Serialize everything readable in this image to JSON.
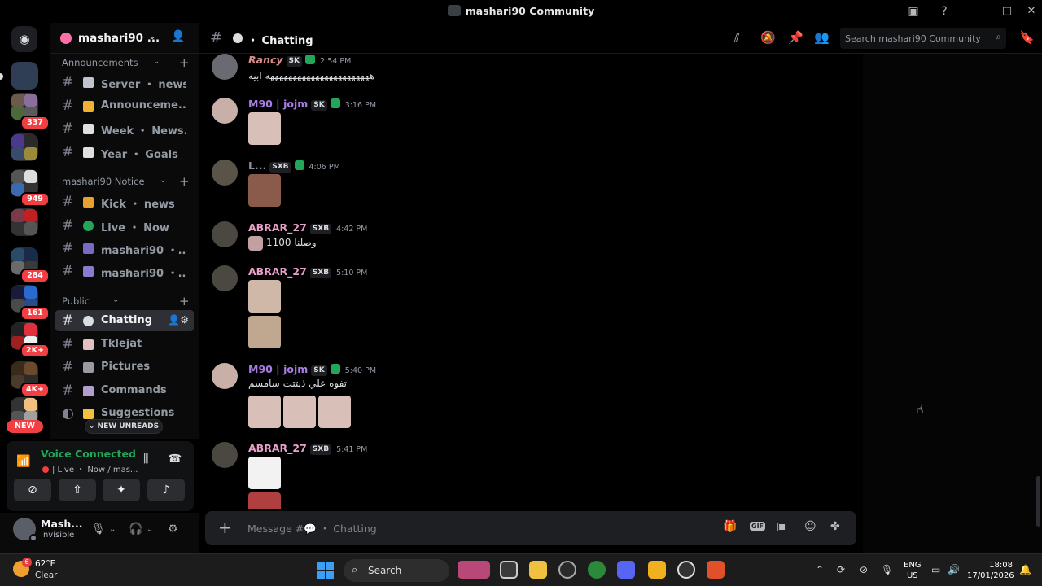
{
  "window": {
    "title": "mashari90 Community"
  },
  "rail": {
    "badges": [
      "337",
      "949",
      "284",
      "161",
      "2K+",
      "4K+"
    ],
    "new_label": "NEW"
  },
  "server": {
    "name": "mashari90 ..."
  },
  "categories": {
    "announcements": "Announcements",
    "notice": "mashari90 Notice",
    "public": "Public"
  },
  "channels": [
    {
      "label": "Server ・ news"
    },
    {
      "label": "Announceme..."
    },
    {
      "label": "Week ・ News..."
    },
    {
      "label": "Year ・ Goals"
    },
    {
      "label": "Kick ・ news"
    },
    {
      "label": "Live ・ Now"
    },
    {
      "label": "mashari90 ・..."
    },
    {
      "label": "mashari90 ・..."
    },
    {
      "label": "Chatting"
    },
    {
      "label": "Tklejat"
    },
    {
      "label": "Pictures"
    },
    {
      "label": "Commands"
    },
    {
      "label": "Suggestions"
    }
  ],
  "new_unreads": "NEW UNREADS",
  "voice": {
    "title": "Voice Connected",
    "subtitle": "| Live ・ Now / mas..."
  },
  "user": {
    "name": "Mash...",
    "status": "Invisible"
  },
  "chat": {
    "channel": "Chatting",
    "search_placeholder": "Search mashari90 Community",
    "composer_placeholder": "Message #💬 ・ Chatting"
  },
  "messages": [
    {
      "author": "Rancy",
      "color": "#d98a8a",
      "tag": "SK",
      "time": "2:54 PM",
      "text": "هههههههههههههههههههههههه ابيه"
    },
    {
      "author": "M90 | jojm",
      "color": "#a67de0",
      "tag": "SK",
      "time": "3:16 PM",
      "text": ""
    },
    {
      "author": "L...",
      "color": "#8a8f98",
      "tag": "SXB",
      "time": "4:06 PM",
      "text": ""
    },
    {
      "author": "ABRAR_27",
      "color": "#e8a0c8",
      "tag": "SXB",
      "time": "4:42 PM",
      "text": "1100 وصلنا"
    },
    {
      "author": "ABRAR_27",
      "color": "#e8a0c8",
      "tag": "SXB",
      "time": "5:10 PM",
      "text": ""
    },
    {
      "author": "M90 | jojm",
      "color": "#a67de0",
      "tag": "SK",
      "time": "5:40 PM",
      "text": "تفوه علي ذبتتت سامسم"
    },
    {
      "author": "ABRAR_27",
      "color": "#e8a0c8",
      "tag": "SXB",
      "time": "5:41 PM",
      "text": ""
    }
  ],
  "taskbar": {
    "temp": "62°F",
    "condition": "Clear",
    "weather_badge": "6",
    "search_label": "Search",
    "lang_top": "ENG",
    "lang_bottom": "US",
    "time": "18:08",
    "date": "17/01/2026"
  }
}
